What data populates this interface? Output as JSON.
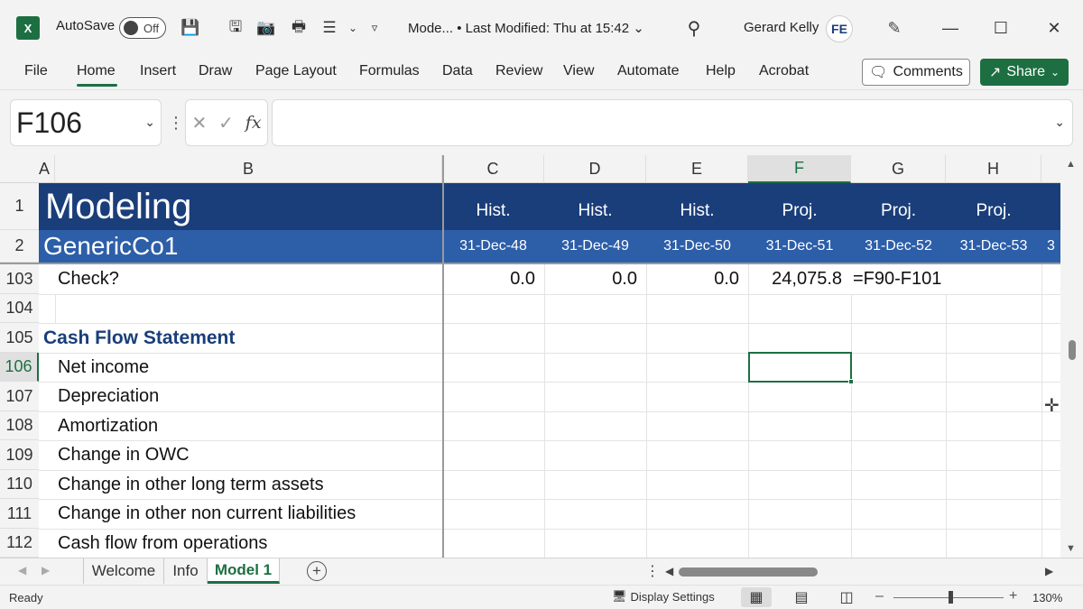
{
  "titlebar": {
    "app_logo": "X",
    "autosave_label": "AutoSave",
    "autosave_state": "Off",
    "doc_title": "Mode... • Last Modified: Thu at 15:42 ⌄",
    "user_name": "Gerard Kelly",
    "avatar_initials": "FE"
  },
  "ribbon": {
    "tabs": [
      "File",
      "Home",
      "Insert",
      "Draw",
      "Page Layout",
      "Formulas",
      "Data",
      "Review",
      "View",
      "Automate",
      "Help",
      "Acrobat"
    ],
    "comments_label": "Comments",
    "share_label": "Share"
  },
  "formula_bar": {
    "name_box": "F106",
    "fx": "fx",
    "formula": ""
  },
  "grid": {
    "columns": [
      "A",
      "B",
      "C",
      "D",
      "E",
      "F",
      "G",
      "H"
    ],
    "selected_column": "F",
    "title": "Modeling",
    "company": "GenericCo1",
    "period_types": [
      "Hist.",
      "Hist.",
      "Hist.",
      "Proj.",
      "Proj.",
      "Proj."
    ],
    "period_dates": [
      "31-Dec-48",
      "31-Dec-49",
      "31-Dec-50",
      "31-Dec-51",
      "31-Dec-52",
      "31-Dec-53"
    ],
    "partial_date": "3",
    "header_rows": [
      "1",
      "2"
    ],
    "rows": [
      {
        "num": "103",
        "label": "Check?",
        "values": [
          "0.0",
          "0.0",
          "0.0",
          "24,075.8"
        ],
        "formula": "=F90-F101"
      },
      {
        "num": "104",
        "label": ""
      },
      {
        "num": "105",
        "section": "Cash Flow Statement"
      },
      {
        "num": "106",
        "label": "Net income"
      },
      {
        "num": "107",
        "label": "Depreciation"
      },
      {
        "num": "108",
        "label": "Amortization"
      },
      {
        "num": "109",
        "label": "Change in OWC"
      },
      {
        "num": "110",
        "label": "Change in other long term assets"
      },
      {
        "num": "111",
        "label": "Change in other non current liabilities"
      },
      {
        "num": "112",
        "label": "Cash flow from operations"
      }
    ],
    "selected_row": "106"
  },
  "sheets": {
    "tabs": [
      "Welcome",
      "Info",
      "Model 1"
    ],
    "active": "Model 1"
  },
  "status": {
    "ready": "Ready",
    "display_settings": "Display Settings",
    "zoom": "130%",
    "zoom_fraction": 0.52
  },
  "colors": {
    "excel_green": "#1d6f42",
    "header_dark_blue": "#1a3e7a",
    "header_mid_blue": "#2d5ea8"
  }
}
